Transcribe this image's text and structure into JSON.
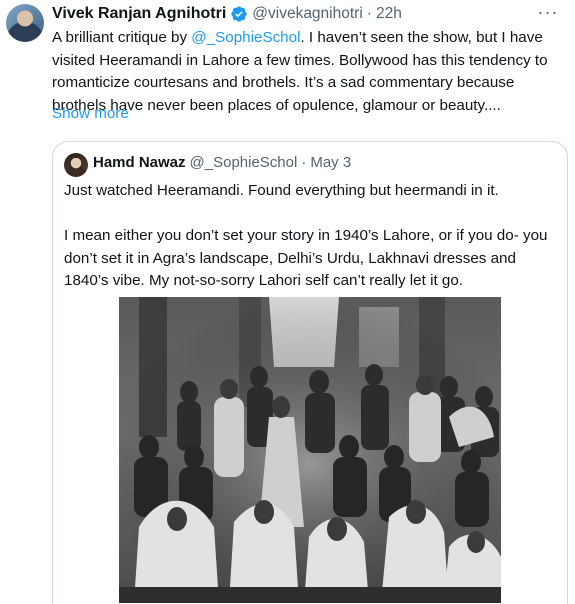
{
  "tweet": {
    "author_name": "Vivek Ranjan Agnihotri",
    "handle": "@vivekagnihotri",
    "separator": "·",
    "time": "22h",
    "more_label": "···",
    "text_lines": [
      {
        "before": "A brilliant critique by ",
        "mention": "@_SophieSchol",
        "after": ". I haven’t seen the show, but I have"
      },
      {
        "before": "visited Heeramandi in Lahore a few times. Bollywood has this tendency to",
        "mention": "",
        "after": ""
      },
      {
        "before": "romanticize courtesans and brothels. It’s a sad commentary because",
        "mention": "",
        "after": ""
      },
      {
        "before": "brothels have never been places of opulence, glamour or beauty....",
        "mention": "",
        "after": ""
      }
    ],
    "show_more": "Show more",
    "colors": {
      "link": "#1d9bf0",
      "muted": "#536471",
      "text": "#0f1419",
      "border": "#cfd9de"
    },
    "verified_icon": "verified-badge-icon"
  },
  "quote": {
    "author_name": "Hamd Nawaz",
    "handle": "@_SophieSchol",
    "separator": "·",
    "date": "May 3",
    "paragraph1": "Just watched Heeramandi. Found everything but heermandi in it.",
    "paragraph2_lines": [
      "I mean either you don’t set your story in 1940’s Lahore, or if you do- you",
      "don’t set it in Agra’s landscape, Delhi’s Urdu, Lakhnavi dresses and",
      "1840’s vibe. My not-so-sorry Lahori self can’t really let it go."
    ]
  }
}
